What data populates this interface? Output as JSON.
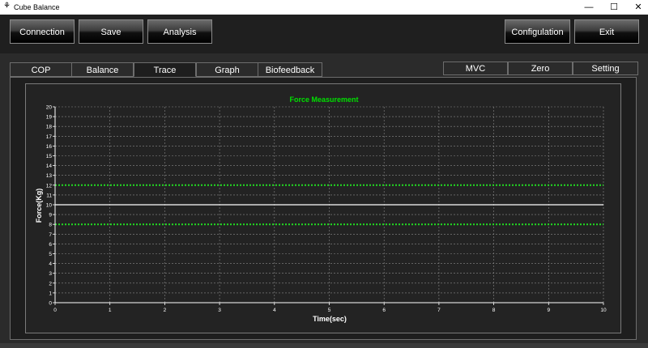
{
  "window": {
    "title": "Cube Balance",
    "icon": "app-feather-icon",
    "minimize_glyph": "—",
    "maximize_glyph": "☐",
    "close_glyph": "✕"
  },
  "toolbar": {
    "connection_label": "Connection",
    "save_label": "Save",
    "analysis_label": "Analysis",
    "configuration_label": "Configulation",
    "exit_label": "Exit"
  },
  "tabs": [
    {
      "label": "COP",
      "active": false
    },
    {
      "label": "Balance",
      "active": false
    },
    {
      "label": "Trace",
      "active": true
    },
    {
      "label": "Graph",
      "active": false
    },
    {
      "label": "Biofeedback",
      "active": false
    }
  ],
  "right_tabs": [
    {
      "label": "MVC"
    },
    {
      "label": "Zero"
    },
    {
      "label": "Setting"
    }
  ],
  "colors": {
    "title": "#00e000",
    "threshold": "#22dd22",
    "target": "#ffffff",
    "grid": "#8a8a8a",
    "axis": "#ffffff"
  },
  "chart_data": {
    "type": "line",
    "title": "Force Measurement",
    "xlabel": "Time(sec)",
    "ylabel": "Force(Kg)",
    "xlim": [
      0,
      10
    ],
    "ylim": [
      0,
      20
    ],
    "xticks": [
      0,
      1,
      2,
      3,
      4,
      5,
      6,
      7,
      8,
      9,
      10
    ],
    "yticks": [
      0,
      1,
      2,
      3,
      4,
      5,
      6,
      7,
      8,
      9,
      10,
      11,
      12,
      13,
      14,
      15,
      16,
      17,
      18,
      19,
      20
    ],
    "grid": true,
    "series": [
      {
        "x": [
          0,
          10
        ],
        "values": [
          12,
          12
        ],
        "style": "dotted",
        "color": "#22dd22"
      },
      {
        "x": [
          0,
          10
        ],
        "values": [
          10,
          10
        ],
        "style": "solid",
        "color": "#ffffff"
      },
      {
        "x": [
          0,
          10
        ],
        "values": [
          8,
          8
        ],
        "style": "dotted",
        "color": "#22dd22"
      }
    ]
  }
}
